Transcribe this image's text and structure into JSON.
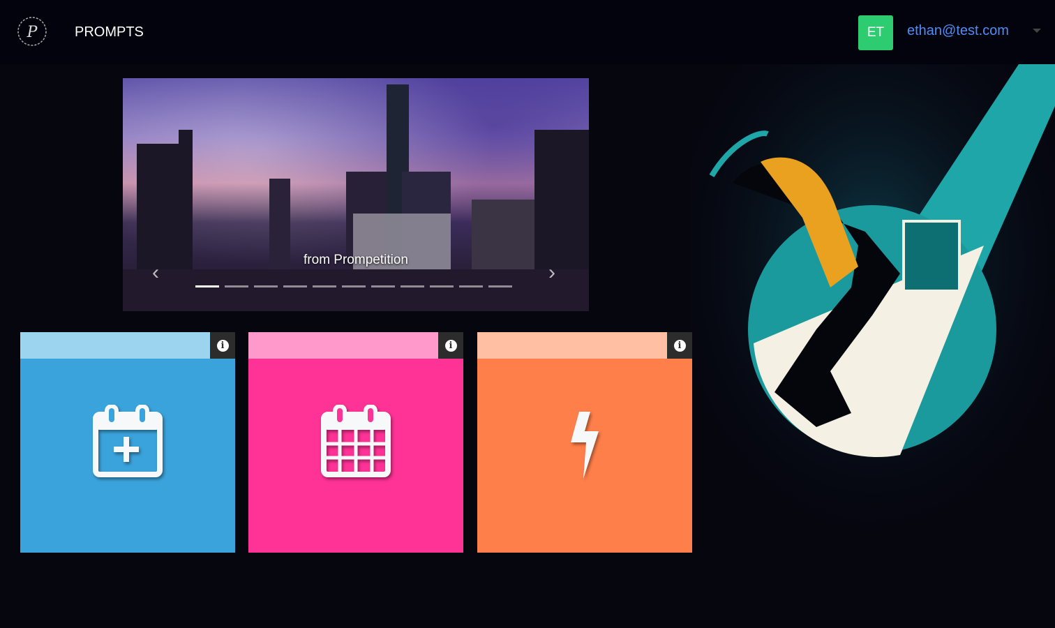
{
  "nav": {
    "brand": "PROMPTS",
    "avatar_initials": "ET",
    "user_email": "ethan@test.com"
  },
  "carousel": {
    "caption": "from Prompetition",
    "slide_count": 11,
    "active_index": 0
  },
  "tiles": [
    {
      "name": "add-event",
      "icon": "calendar-plus-icon",
      "color": "#3ba3db",
      "header_color": "#9cd3ee"
    },
    {
      "name": "calendar",
      "icon": "calendar-icon",
      "color": "#ff3296",
      "header_color": "#ff99cb"
    },
    {
      "name": "quick",
      "icon": "lightning-icon",
      "color": "#ff7f4a",
      "header_color": "#ffbfa3"
    }
  ]
}
